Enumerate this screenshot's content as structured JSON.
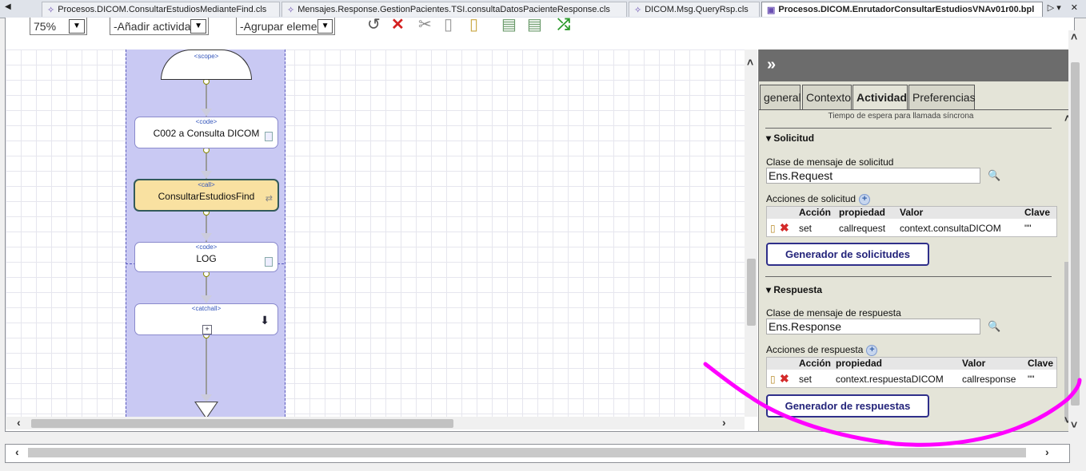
{
  "tabs": {
    "items": [
      {
        "label": "Procesos.DICOM.ConsultarEstudiosMedianteFind.cls",
        "active": false
      },
      {
        "label": "Mensajes.Response.GestionPacientes.TSI.consultaDatosPacienteResponse.cls",
        "active": false
      },
      {
        "label": "DICOM.Msg.QueryRsp.cls",
        "active": false
      },
      {
        "label": "Procesos.DICOM.EnrutadorConsultarEstudiosVNAv01r00.bpl",
        "active": true
      }
    ]
  },
  "toolbar": {
    "zoom": "75%",
    "add_activity": "-Añadir activida",
    "group_elements": "-Agrupar elemen"
  },
  "diagram": {
    "scope_label": "<scope>",
    "code1_kind": "<code>",
    "code1_name": "C002 a Consulta DICOM",
    "call_kind": "<call>",
    "call_name": "ConsultarEstudiosFind",
    "code2_kind": "<code>",
    "code2_name": "LOG",
    "catchall_kind": "<catchall>",
    "catchall_plus": "+"
  },
  "panel": {
    "collapse_label": "»",
    "tabs": [
      "general",
      "Contexto",
      "Actividad",
      "Preferencias"
    ],
    "active_tab": "Actividad",
    "timeout_note": "Tiempo de espera para llamada síncrona",
    "request": {
      "section_title": "Solicitud",
      "class_label": "Clase de mensaje de solicitud",
      "class_value": "Ens.Request",
      "actions_label": "Acciones de solicitud",
      "columns": [
        "Acción",
        "propiedad",
        "Valor",
        "Clave"
      ],
      "rows": [
        {
          "accion": "set",
          "propiedad": "callrequest",
          "valor": "context.consultaDICOM",
          "clave": "\"\""
        }
      ],
      "button": "Generador de solicitudes"
    },
    "response": {
      "section_title": "Respuesta",
      "class_label": "Clase de mensaje de respuesta",
      "class_value": "Ens.Response",
      "actions_label": "Acciones de respuesta",
      "columns": [
        "Acción",
        "propiedad",
        "Valor",
        "Clave"
      ],
      "rows": [
        {
          "accion": "set",
          "propiedad": "context.respuestaDICOM",
          "valor": "callresponse",
          "clave": "\"\""
        }
      ],
      "button": "Generador de respuestas"
    }
  },
  "colors": {
    "lane": "#c9c9f3",
    "call_fill": "#f9e1a1",
    "annotation": "#ff00ff",
    "panel_bg": "#e4e4d8"
  }
}
